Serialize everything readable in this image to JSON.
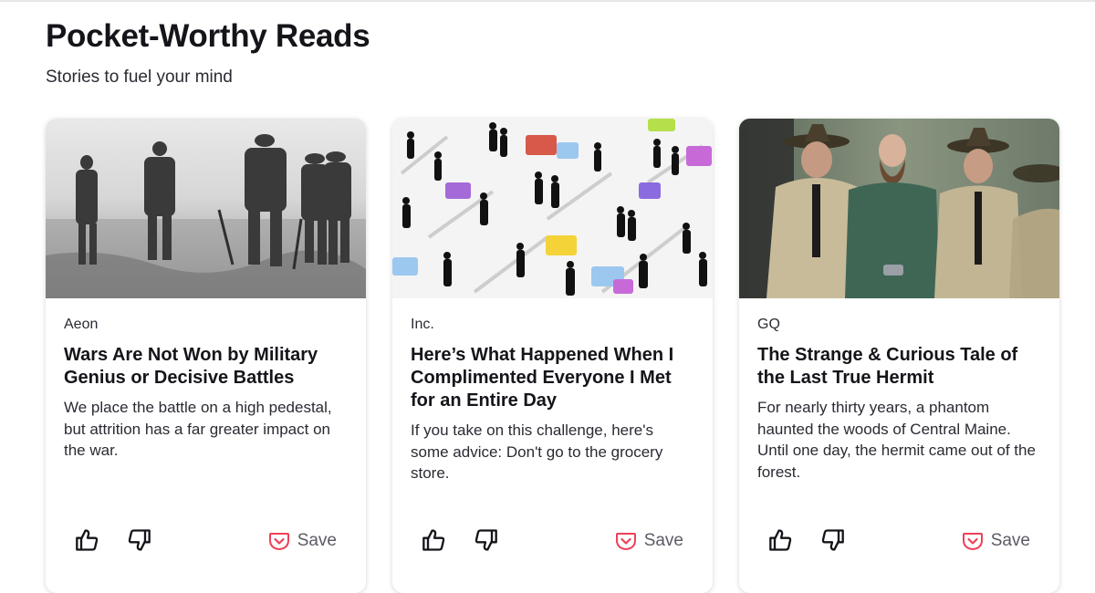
{
  "section": {
    "title": "Pocket-Worthy Reads",
    "subtitle": "Stories to fuel your mind"
  },
  "colors": {
    "pocket_red": "#ef4056",
    "text_primary": "#15141a",
    "text_secondary": "#2b2a33"
  },
  "cards": [
    {
      "publisher": "Aeon",
      "headline": "Wars Are Not Won by Military Genius or Decisive Battles",
      "excerpt": "We place the battle on a high pedestal, but attrition has a far greater impact on the war.",
      "save_label": "Save",
      "icons": [
        "thumbs-up-icon",
        "thumbs-down-icon",
        "pocket-icon"
      ]
    },
    {
      "publisher": "Inc.",
      "headline": "Here’s What Happened When I Complimented Everyone I Met for an Entire Day",
      "excerpt": "If you take on this challenge, here's some advice: Don't go to the grocery store.",
      "save_label": "Save",
      "icons": [
        "thumbs-up-icon",
        "thumbs-down-icon",
        "pocket-icon"
      ]
    },
    {
      "publisher": "GQ",
      "headline": "The Strange & Curious Tale of the Last True Hermit",
      "excerpt": "For nearly thirty years, a phantom haunted the woods of Central Maine. Until one day, the hermit came out of the forest.",
      "save_label": "Save",
      "icons": [
        "thumbs-up-icon",
        "thumbs-down-icon",
        "pocket-icon"
      ]
    }
  ]
}
